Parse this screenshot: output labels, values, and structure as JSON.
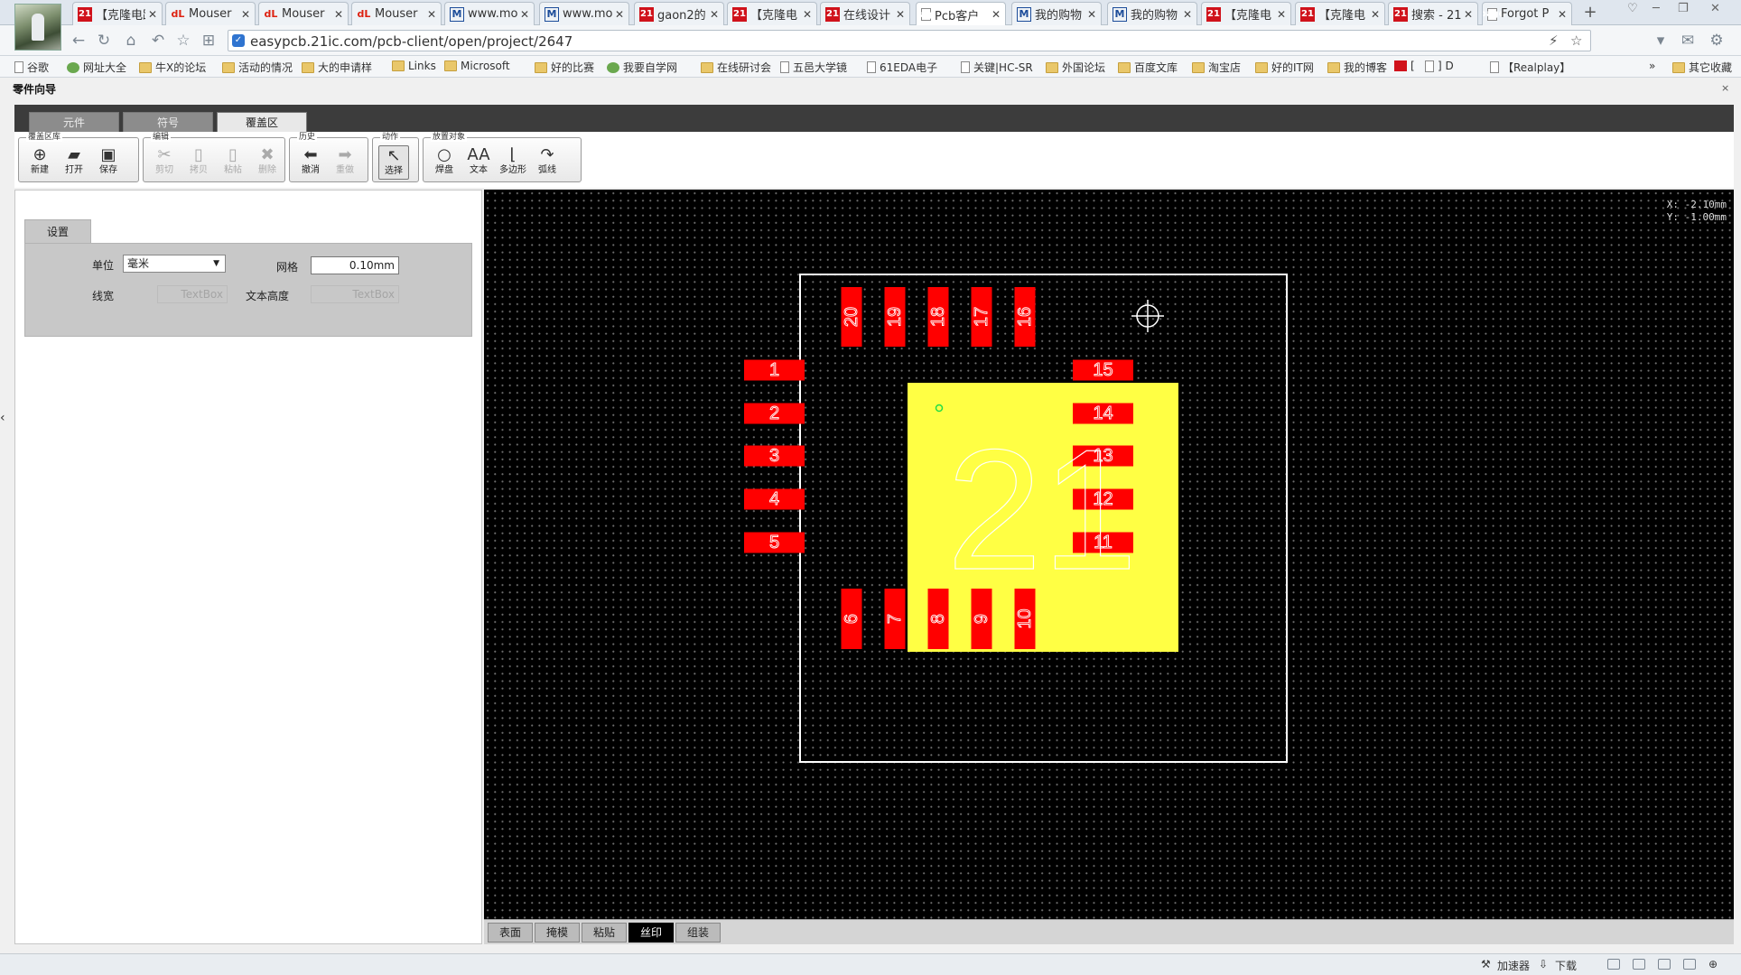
{
  "browser": {
    "tabs": [
      {
        "favicon": "21",
        "title": "【克隆电路"
      },
      {
        "favicon": "dL",
        "title": "Mouser"
      },
      {
        "favicon": "dL",
        "title": "Mouser"
      },
      {
        "favicon": "dL",
        "title": "Mouser"
      },
      {
        "favicon": "M",
        "title": "www.mou"
      },
      {
        "favicon": "M",
        "title": "www.mou"
      },
      {
        "favicon": "21",
        "title": "gaon2的"
      },
      {
        "favicon": "21",
        "title": "【克隆电"
      },
      {
        "favicon": "21",
        "title": "在线设计"
      },
      {
        "favicon": "page",
        "title": "Pcb客户",
        "active": true
      },
      {
        "favicon": "M",
        "title": "我的购物"
      },
      {
        "favicon": "M",
        "title": "我的购物"
      },
      {
        "favicon": "21",
        "title": "【克隆电"
      },
      {
        "favicon": "21",
        "title": "【克隆电"
      },
      {
        "favicon": "21",
        "title": "搜索 - 21"
      },
      {
        "favicon": "page",
        "title": "Forgot P"
      }
    ],
    "new_tab": "+",
    "url": "easypcb.21ic.com/pcb-client/open/project/2647",
    "bookmarks": [
      {
        "icon": "page",
        "label": "谷歌"
      },
      {
        "icon": "globe",
        "label": "网址大全"
      },
      {
        "icon": "folder",
        "label": "牛X的论坛"
      },
      {
        "icon": "folder",
        "label": "活动的情况"
      },
      {
        "icon": "folder",
        "label": "大的申请样"
      },
      {
        "icon": "folder",
        "label": "Links"
      },
      {
        "icon": "folder",
        "label": "Microsoft"
      },
      {
        "icon": "folder",
        "label": "好的比赛"
      },
      {
        "icon": "globe",
        "label": "我要自学网"
      },
      {
        "icon": "folder",
        "label": "在线研讨会"
      },
      {
        "icon": "page",
        "label": "五邑大学镜"
      },
      {
        "icon": "page",
        "label": "61EDA电子"
      },
      {
        "icon": "page",
        "label": "关键|HC-SR"
      },
      {
        "icon": "folder",
        "label": "外国论坛"
      },
      {
        "icon": "folder",
        "label": "百度文库"
      },
      {
        "icon": "folder",
        "label": "淘宝店"
      },
      {
        "icon": "folder",
        "label": "好的IT网"
      },
      {
        "icon": "folder",
        "label": "我的博客"
      },
      {
        "icon": "21",
        "label": "["
      },
      {
        "icon": "page",
        "label": "] D"
      },
      {
        "icon": "page",
        "label": "【Realplay】"
      }
    ],
    "bookmarks_more": "»",
    "bookmarks_other": "其它收藏",
    "status": {
      "accelerator": "加速器",
      "download": "下载"
    }
  },
  "app": {
    "title": "零件向导",
    "close": "×",
    "tabs": [
      {
        "label": "元件",
        "active": false
      },
      {
        "label": "符号",
        "active": false
      },
      {
        "label": "覆盖区",
        "active": true
      }
    ],
    "ribbon": {
      "groups": [
        {
          "label": "覆盖区库",
          "buttons": [
            {
              "label": "新建",
              "icon": "new-icon",
              "glyph": "⊕",
              "enabled": true
            },
            {
              "label": "打开",
              "icon": "open-folder-icon",
              "glyph": "▰",
              "enabled": true
            },
            {
              "label": "保存",
              "icon": "save-icon",
              "glyph": "▣",
              "enabled": true
            }
          ]
        },
        {
          "label": "编辑",
          "buttons": [
            {
              "label": "剪切",
              "icon": "cut-icon",
              "glyph": "✂",
              "enabled": false
            },
            {
              "label": "拷贝",
              "icon": "copy-icon",
              "glyph": "▯",
              "enabled": false
            },
            {
              "label": "粘帖",
              "icon": "paste-icon",
              "glyph": "▯",
              "enabled": false
            },
            {
              "label": "删除",
              "icon": "delete-icon",
              "glyph": "✖",
              "enabled": false
            }
          ]
        },
        {
          "label": "历史",
          "buttons": [
            {
              "label": "撤消",
              "icon": "undo-icon",
              "glyph": "⬅",
              "enabled": true
            },
            {
              "label": "重做",
              "icon": "redo-icon",
              "glyph": "➡",
              "enabled": false
            }
          ]
        },
        {
          "label": "动作",
          "buttons": [
            {
              "label": "选择",
              "icon": "select-arrow-icon",
              "glyph": "↖",
              "enabled": true,
              "selected": true
            }
          ]
        },
        {
          "label": "放置对象",
          "buttons": [
            {
              "label": "焊盘",
              "icon": "pad-icon",
              "glyph": "○",
              "enabled": true
            },
            {
              "label": "文本",
              "icon": "text-icon",
              "glyph": "AA",
              "enabled": true
            },
            {
              "label": "多边形",
              "icon": "polygon-icon",
              "glyph": "⌊",
              "enabled": true
            },
            {
              "label": "弧线",
              "icon": "arc-icon",
              "glyph": "↷",
              "enabled": true
            }
          ]
        }
      ]
    },
    "settings": {
      "tab": "设置",
      "unit_label": "单位",
      "unit_value": "毫米",
      "grid_label": "网格",
      "grid_value": "0.10mm",
      "line_width_label": "线宽",
      "line_width_placeholder": "TextBox",
      "text_height_label": "文本高度",
      "text_height_placeholder": "TextBox"
    },
    "canvas": {
      "coord_x": "X: -2.10mm",
      "coord_y": "Y: -1.00mm",
      "courtyard_number": "21",
      "pads_top": [
        "20",
        "19",
        "18",
        "17",
        "16"
      ],
      "pads_bottom": [
        "6",
        "7",
        "8",
        "9",
        "10"
      ],
      "pads_left": [
        "1",
        "2",
        "3",
        "4",
        "5"
      ],
      "pads_right": [
        "15",
        "14",
        "13",
        "12",
        "11"
      ]
    },
    "layer_tabs": [
      {
        "label": "表面",
        "active": false
      },
      {
        "label": "掩模",
        "active": false
      },
      {
        "label": "粘贴",
        "active": false
      },
      {
        "label": "丝印",
        "active": true
      },
      {
        "label": "组装",
        "active": false
      }
    ],
    "colors": {
      "pad": "#ff0000",
      "body": "#ffff44",
      "outline": "#ffffff",
      "canvas_bg": "#000000"
    }
  }
}
